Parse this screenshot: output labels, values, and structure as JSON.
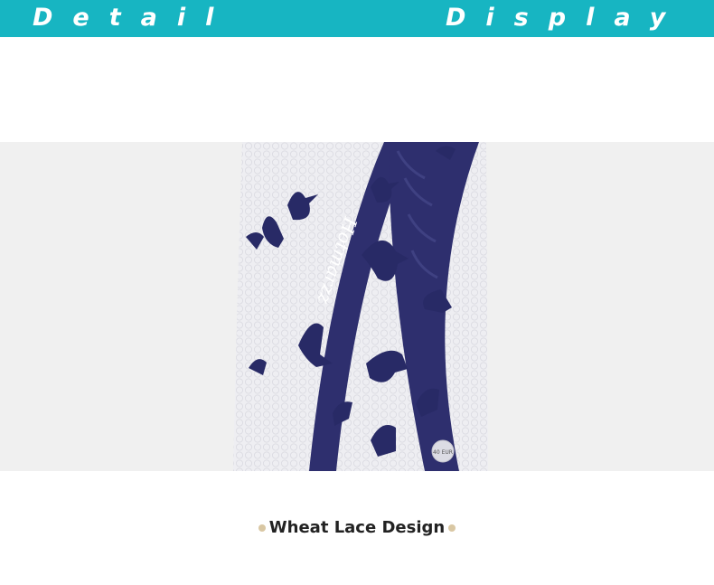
{
  "banner": {
    "left_word": "Detail",
    "right_word": "Display",
    "color": "#17b5c2"
  },
  "product": {
    "strap_brand": "Hotmarzz",
    "size_mark": "40 EUR",
    "strap_color": "#2e2f6e",
    "sole_color": "#eeeef2",
    "bird_color": "#282a66"
  },
  "caption": {
    "text": "Wheat Lace Design",
    "dot_color": "#d9c7a3"
  }
}
